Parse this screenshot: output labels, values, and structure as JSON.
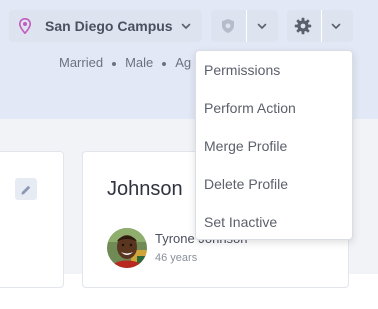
{
  "toolbar": {
    "campus_label": "San Diego Campus"
  },
  "person_info": {
    "marital_status": "Married",
    "gender": "Male",
    "age_truncated": "Ag"
  },
  "dropdown_menu": {
    "items": [
      "Permissions",
      "Perform Action",
      "Merge Profile",
      "Delete Profile",
      "Set Inactive"
    ]
  },
  "family_card": {
    "family_name": "Johnson",
    "member_name": "Tyrone Johnson",
    "member_age": "46 years"
  },
  "colors": {
    "campus_icon": "#c35ac0",
    "top_band": "#e2e8f6",
    "button_bg": "#dde3ef"
  },
  "icons": {
    "campus": "map-pin-icon",
    "security": "shield-icon",
    "settings": "gear-icon",
    "edit": "pencil-icon",
    "expand": "chevron-down-icon"
  }
}
